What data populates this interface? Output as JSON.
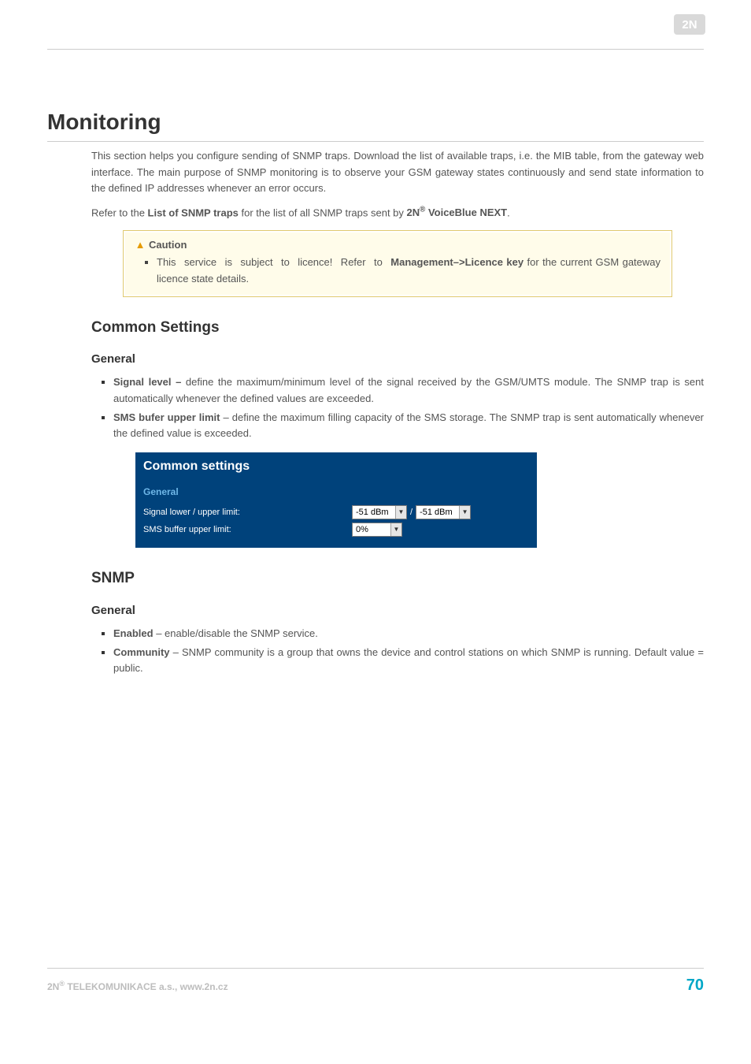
{
  "header": {
    "logo_label": "2N"
  },
  "title": "Monitoring",
  "intro_html": "This section helps you configure sending of SNMP traps. Download the list of available traps, i.e. the MIB table, from the gateway web interface. The main purpose of SNMP monitoring is to observe your GSM gateway states continuously and send state information to the defined IP addresses whenever an error occurs.",
  "refer_prefix": "Refer to the ",
  "refer_bold": "List of SNMP traps",
  "refer_mid": " for the list of all SNMP traps sent by ",
  "refer_product": "2N",
  "refer_product_sup": "®",
  "refer_product_tail": " VoiceBlue NEXT",
  "refer_suffix": ".",
  "caution": {
    "heading": "Caution",
    "bullet_prefix": "This service is subject to licence! Refer to ",
    "bullet_bold": "Management–>Licence key",
    "bullet_suffix": " for the current GSM gateway licence state details."
  },
  "section_common": {
    "heading": "Common Settings",
    "sub_general": "General",
    "items": [
      {
        "label": "Signal level – ",
        "text": "define the maximum/minimum level of the signal received by the GSM/UMTS module. The SNMP trap is sent automatically whenever the defined values are exceeded."
      },
      {
        "label": "SMS bufer upper limit",
        "text": " – define the maximum filling capacity of the SMS storage. The SNMP trap is sent automatically whenever the defined value is exceeded."
      }
    ]
  },
  "screenshot": {
    "title": "Common settings",
    "section": "General",
    "row1_label": "Signal lower / upper limit:",
    "row1_val1": "-51 dBm",
    "row1_val2": "-51 dBm",
    "row2_label": "SMS buffer upper limit:",
    "row2_val": "0%"
  },
  "section_snmp": {
    "heading": "SNMP",
    "sub_general": "General",
    "items": [
      {
        "label": "Enabled",
        "text": " – enable/disable the SNMP service."
      },
      {
        "label": "Community",
        "text": " –  SNMP community is a group that owns the device and control stations on which SNMP is running. Default value = public."
      }
    ]
  },
  "footer": {
    "left_prefix": "2N",
    "left_sup": "®",
    "left_suffix": " TELEKOMUNIKACE a.s., www.2n.cz",
    "page": "70"
  }
}
